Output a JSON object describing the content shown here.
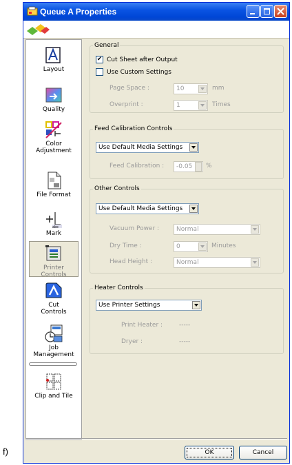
{
  "figure_letter": "f)",
  "window": {
    "title": "Queue A Properties"
  },
  "sidebar": {
    "items": [
      {
        "label": "Layout",
        "icon": "layout-icon"
      },
      {
        "label": "Quality",
        "icon": "quality-icon"
      },
      {
        "label": "Color Adjustment",
        "line1": "Color",
        "line2": "Adjustment",
        "icon": "color-adjustment-icon"
      },
      {
        "label": "File Format",
        "icon": "file-format-icon"
      },
      {
        "label": "Mark",
        "icon": "mark-icon"
      },
      {
        "label": "Printer Controls",
        "line1": "Printer",
        "line2": "Controls",
        "icon": "printer-controls-icon"
      },
      {
        "label": "Cut Controls",
        "line1": "Cut",
        "line2": "Controls",
        "icon": "cut-controls-icon"
      },
      {
        "label": "Job Management",
        "line1": "Job",
        "line2": "Management",
        "icon": "job-management-icon"
      },
      {
        "label": "Clip and Tile",
        "icon": "clip-and-tile-icon"
      }
    ]
  },
  "general": {
    "legend": "General",
    "cut_sheet": {
      "label": "Cut Sheet after Output",
      "checked": true
    },
    "custom_settings": {
      "label": "Use Custom Settings",
      "checked": false
    },
    "page_space": {
      "label": "Page Space :",
      "value": "10",
      "unit": "mm"
    },
    "overprint": {
      "label": "Overprint :",
      "value": "1",
      "unit": "Times"
    }
  },
  "feed_calibration": {
    "legend": "Feed Calibration Controls",
    "mode": "Use Default Media Settings",
    "calibration": {
      "label": "Feed Calibration :",
      "value": "-0.05",
      "unit": "%"
    }
  },
  "other_controls": {
    "legend": "Other Controls",
    "mode": "Use Default Media Settings",
    "vacuum": {
      "label": "Vacuum Power :",
      "value": "Normal"
    },
    "dry_time": {
      "label": "Dry Time :",
      "value": "0",
      "unit": "Minutes"
    },
    "head_height": {
      "label": "Head Height :",
      "value": "Normal"
    }
  },
  "heater_controls": {
    "legend": "Heater Controls",
    "mode": "Use Printer Settings",
    "print_heater": {
      "label": "Print Heater :",
      "value": "-----"
    },
    "dryer": {
      "label": "Dryer :",
      "value": "-----"
    }
  },
  "buttons": {
    "ok": "OK",
    "cancel": "Cancel"
  },
  "colors": {
    "titlebar": "#0a54e3",
    "dialog": "#ece9d8",
    "disabled_text": "#9a9a9a"
  }
}
